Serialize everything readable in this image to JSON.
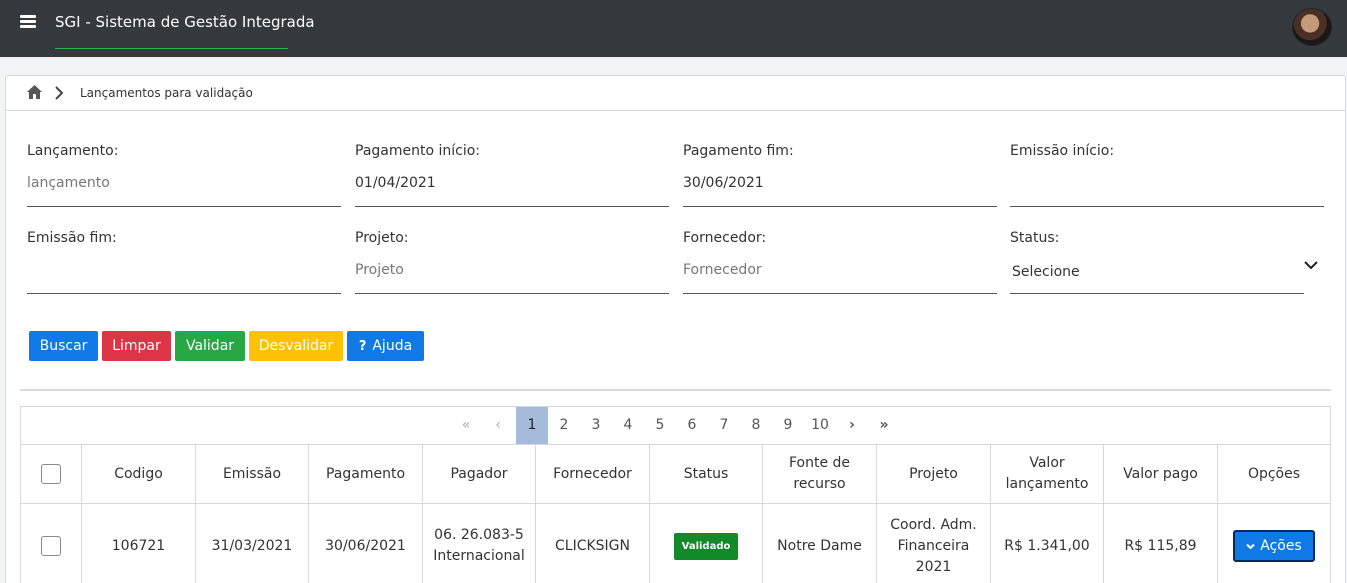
{
  "app": {
    "title": "SGI - Sistema de Gestão Integrada"
  },
  "nav": {
    "menu_icon": "hamburger-menu-icon",
    "avatar_icon": "user-avatar"
  },
  "breadcrumb": {
    "home_icon": "home-icon",
    "separator_icon": "chevron-right-icon",
    "current": "Lançamentos para validação"
  },
  "filters": {
    "lancamento": {
      "label": "Lançamento:",
      "value": "",
      "placeholder": "lançamento"
    },
    "pagamento_inicio": {
      "label": "Pagamento início:",
      "value": "01/04/2021"
    },
    "pagamento_fim": {
      "label": "Pagamento fim:",
      "value": "30/06/2021"
    },
    "emissao_inicio": {
      "label": "Emissão início:",
      "value": ""
    },
    "emissao_fim": {
      "label": "Emissão fim:",
      "value": ""
    },
    "projeto": {
      "label": "Projeto:",
      "value": "",
      "placeholder": "Projeto"
    },
    "fornecedor": {
      "label": "Fornecedor:",
      "value": "",
      "placeholder": "Fornecedor"
    },
    "status": {
      "label": "Status:",
      "selected": "Selecione"
    }
  },
  "actions": {
    "buscar": "Buscar",
    "limpar": "Limpar",
    "validar": "Validar",
    "desvalidar": "Desvalidar",
    "ajuda_icon": "?",
    "ajuda": "Ajuda"
  },
  "colors": {
    "primary": "#0f7ae5",
    "danger": "#dc3545",
    "success": "#28a745",
    "warning": "#ffc107",
    "navbar": "#33393d",
    "badge": "#138a2a"
  },
  "pagination": {
    "first": "«",
    "prev": "‹",
    "pages": [
      "1",
      "2",
      "3",
      "4",
      "5",
      "6",
      "7",
      "8",
      "9",
      "10"
    ],
    "current": "1",
    "next": "›",
    "last": "»"
  },
  "table": {
    "columns": [
      "Codigo",
      "Emissão",
      "Pagamento",
      "Pagador",
      "Fornecedor",
      "Status",
      "Fonte de recurso",
      "Projeto",
      "Valor lançamento",
      "Valor pago",
      "Opções"
    ],
    "rows": [
      {
        "codigo": "106721",
        "emissao": "31/03/2021",
        "pagamento": "30/06/2021",
        "pagador": "06. 26.083-5 Internacional",
        "fornecedor": "CLICKSIGN",
        "status": "Validado",
        "fonte": "Notre Dame",
        "projeto": "Coord. Adm. Financeira 2021",
        "valor_lancamento": "R$ 1.341,00",
        "valor_pago": "R$ 115,89",
        "acoes": "Ações"
      }
    ]
  }
}
